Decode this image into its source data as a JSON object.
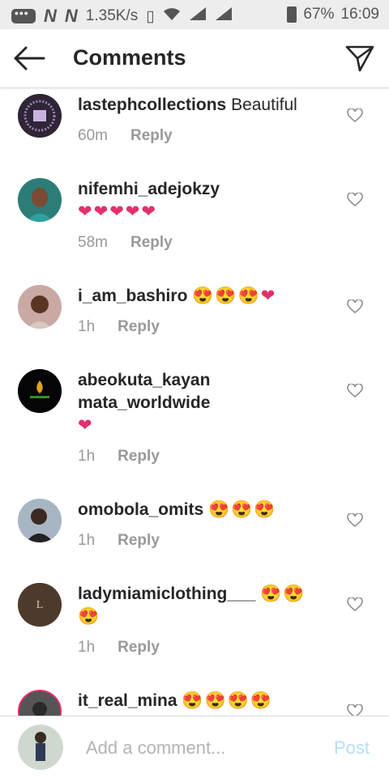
{
  "status_bar": {
    "speed": "1.35K/s",
    "battery": "67%",
    "time": "16:09",
    "n_icons": [
      "N",
      "N"
    ]
  },
  "header": {
    "title": "Comments"
  },
  "comments": [
    {
      "username": "lastephcollections",
      "text": "Beautiful",
      "emoji": "",
      "time": "60m",
      "reply": "Reply"
    },
    {
      "username": "nifemhi_adejokzy",
      "text": "",
      "emoji": "❤❤❤❤❤",
      "time": "58m",
      "reply": "Reply"
    },
    {
      "username": "i_am_bashiro",
      "text": "",
      "emoji": "😍😍😍❤",
      "time": "1h",
      "reply": "Reply"
    },
    {
      "username": "abeokuta_kayan mata_worldwide",
      "text": "",
      "emoji": "❤",
      "time": "1h",
      "reply": "Reply"
    },
    {
      "username": "omobola_omits",
      "text": "",
      "emoji": "😍😍😍",
      "time": "1h",
      "reply": "Reply"
    },
    {
      "username": "ladymiamiclothing___",
      "text": "",
      "emoji": "😍😍😍",
      "time": "1h",
      "reply": "Reply"
    },
    {
      "username": "it_real_mina",
      "text": "",
      "emoji": "😍😍😍😍",
      "time": "",
      "reply": ""
    }
  ],
  "footer": {
    "placeholder": "Add a comment...",
    "post_label": "Post"
  },
  "colors": {
    "accent": "#3897f0",
    "post_disabled": "#b2dffc",
    "heart_emoji": "#e1306c"
  }
}
